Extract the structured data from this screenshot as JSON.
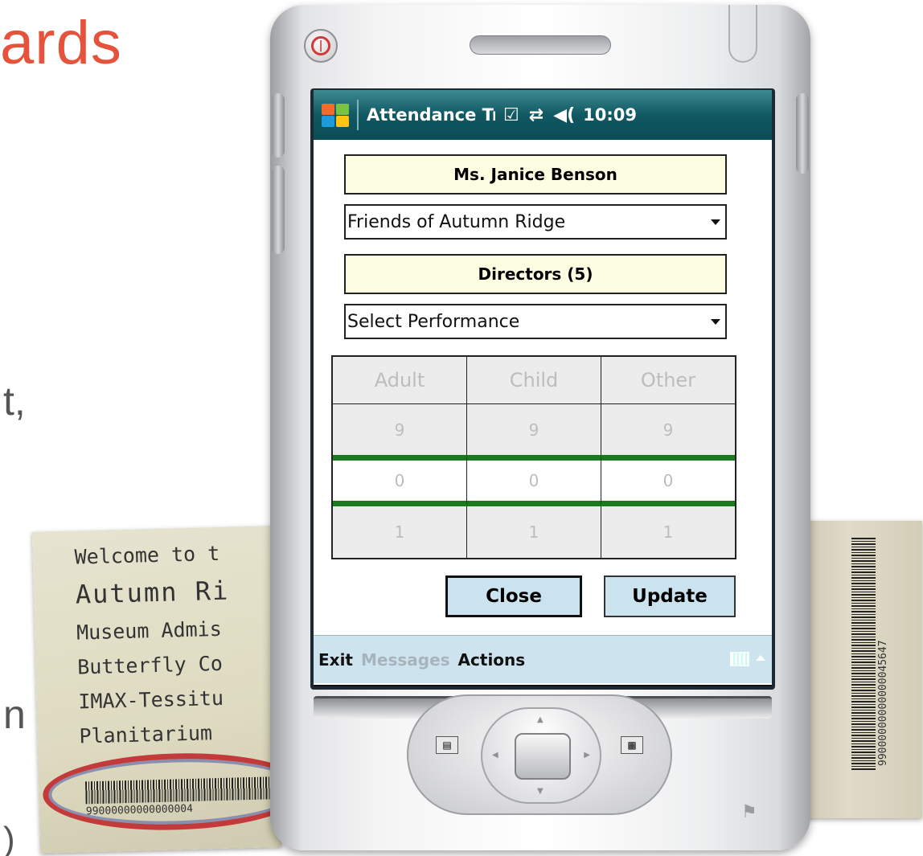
{
  "slide": {
    "title_fragment": "ards",
    "line_fragment_1": "t,",
    "line_fragment_2": "n",
    "line_fragment_3": ")"
  },
  "ticket_left": {
    "lines": [
      "Welcome to t",
      "Autumn Ri",
      "Museum Admis",
      "Butterfly Co",
      "IMAX-Tessitu",
      "Planitarium"
    ],
    "barcode_number": "99000000000000004"
  },
  "ticket_right": {
    "barcode_number": "99000000000000045647"
  },
  "status_bar": {
    "app_title": "Attendance Tr",
    "time": "10:09",
    "icons": [
      "checkbox-icon",
      "connectivity-icon",
      "speaker-icon"
    ]
  },
  "form": {
    "teacher_name": "Ms. Janice Benson",
    "organization_select": "Friends of Autumn Ridge",
    "group_label": "Directors (5)",
    "performance_select": "Select Performance"
  },
  "grid": {
    "headers": [
      "Adult",
      "Child",
      "Other"
    ],
    "rows": [
      [
        "9",
        "9",
        "9"
      ],
      [
        "0",
        "0",
        "0"
      ],
      [
        "1",
        "1",
        "1"
      ]
    ]
  },
  "buttons": {
    "close": "Close",
    "update": "Update"
  },
  "menu": {
    "exit": "Exit",
    "messages": "Messages",
    "actions": "Actions"
  },
  "colors": {
    "title_bar": "#105862",
    "highlight_box": "#fdfde2",
    "button": "#cbe3ee",
    "grid_separator": "#197a1e",
    "slide_title": "#e5533d"
  }
}
